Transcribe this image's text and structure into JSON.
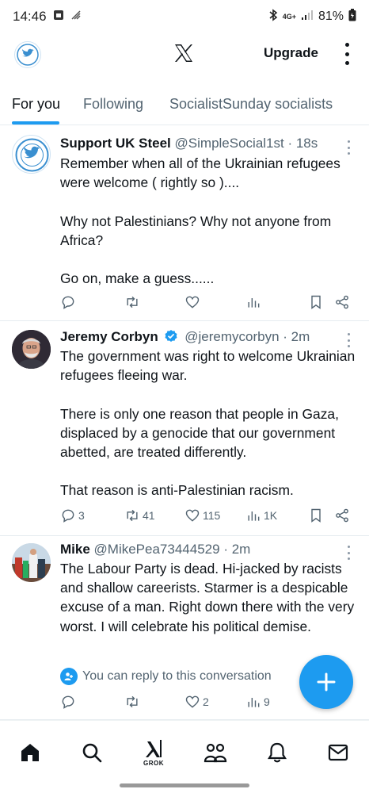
{
  "status_bar": {
    "time": "14:46",
    "network": "4G+",
    "battery": "81%"
  },
  "header": {
    "upgrade_label": "Upgrade"
  },
  "tabs": [
    {
      "label": "For you",
      "active": true
    },
    {
      "label": "Following",
      "active": false
    },
    {
      "label": "SocialistSunday socialists",
      "active": false
    }
  ],
  "tweets": [
    {
      "name": "Support UK Steel",
      "handle": "@SimpleSocial1st",
      "time": "· 18s",
      "verified": false,
      "paragraphs": [
        "Remember when all of the Ukrainian refugees were welcome ( rightly so )....",
        "Why not Palestinians? Why not anyone from Africa?",
        "Go on, make a guess......"
      ],
      "stats": {
        "replies": "",
        "reposts": "",
        "likes": "",
        "views": ""
      }
    },
    {
      "name": "Jeremy Corbyn",
      "handle": "@jeremycorbyn",
      "time": "· 2m",
      "verified": true,
      "paragraphs": [
        "The government was right to welcome Ukrainian refugees fleeing war.",
        "There is only one reason that people in Gaza, displaced by a genocide that our government abetted, are treated differently.",
        "That reason is anti-Palestinian racism."
      ],
      "stats": {
        "replies": "3",
        "reposts": "41",
        "likes": "115",
        "views": "1K"
      }
    },
    {
      "name": "Mike",
      "handle": "@MikePea73444529",
      "time": "· 2m",
      "verified": false,
      "paragraphs": [
        "The Labour Party is dead. Hi-jacked by racists and shallow careerists. Starmer is a despicable excuse of a man. Right down there with the very worst. I will celebrate his political demise."
      ],
      "reply_note": "You can reply to this conversation",
      "stats": {
        "replies": "",
        "reposts": "",
        "likes": "2",
        "views": "9"
      }
    }
  ],
  "bottom_nav": {
    "grok_label": "GROK"
  },
  "colors": {
    "accent": "#1d9bf0",
    "text": "#0f1419",
    "muted": "#536471",
    "divider": "#e6ecf0"
  },
  "icons": [
    "home-icon",
    "search-icon",
    "grok-icon",
    "communities-icon",
    "notifications-icon",
    "messages-icon"
  ]
}
